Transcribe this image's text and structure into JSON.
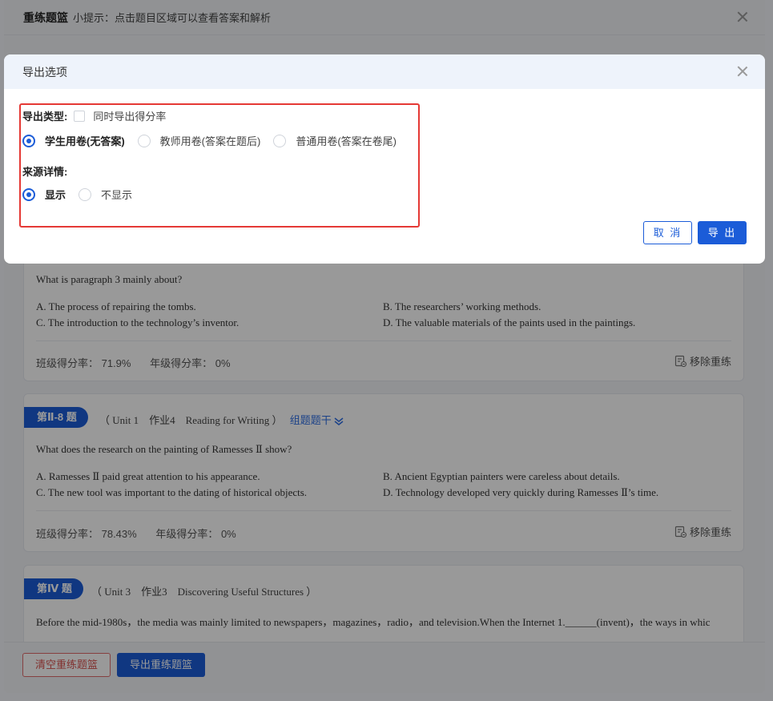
{
  "drawer": {
    "title": "重练题篮",
    "tip": "小提示：点击题目区域可以查看答案和解析"
  },
  "questions": [
    {
      "badge": "",
      "source": "",
      "group_label": "",
      "text": "What is paragraph 3 mainly about?",
      "options": [
        "A. The process of repairing the tombs.",
        "B. The researchers’ working methods.",
        "C. The introduction to the technology’s inventor.",
        "D. The valuable materials of the paints used in the paintings."
      ],
      "class_rate": "班级得分率： 71.9%",
      "grade_rate": "年级得分率： 0%",
      "remove_label": "移除重练"
    },
    {
      "badge": "第Ⅱ-8 题",
      "source": "（ Unit 1　作业4　Reading for Writing ）",
      "group_label": "组题题干",
      "text": "What does the research on the painting of Ramesses Ⅱ show?",
      "options": [
        "A. Ramesses Ⅱ paid great attention to his appearance.",
        "B. Ancient Egyptian painters were careless about details.",
        "C. The new tool was important to the dating of historical objects.",
        "D. Technology developed very quickly during Ramesses Ⅱ’s time."
      ],
      "class_rate": "班级得分率： 78.43%",
      "grade_rate": "年级得分率： 0%",
      "remove_label": "移除重练"
    },
    {
      "badge": "第Ⅳ 题",
      "source": "（ Unit 3　作业3　Discovering Useful Structures ）",
      "text": "Before the mid-1980s，the media was mainly limited to newspapers，magazines，radio，and television.When the Internet 1.______(invent)，the ways in whic"
    }
  ],
  "footer": {
    "clear_label": "清空重练题篮",
    "export_label": "导出重练题篮"
  },
  "modal": {
    "title": "导出选项",
    "export_type_label": "导出类型:",
    "export_rate_label": "同时导出得分率",
    "paper_options": [
      {
        "label": "学生用卷(无答案)",
        "selected": true
      },
      {
        "label": "教师用卷(答案在题后)",
        "selected": false
      },
      {
        "label": "普通用卷(答案在卷尾)",
        "selected": false
      }
    ],
    "source_label": "来源详情:",
    "source_options": [
      {
        "label": "显示",
        "selected": true
      },
      {
        "label": "不显示",
        "selected": false
      }
    ],
    "cancel_label": "取 消",
    "export_label": "导 出"
  },
  "colors": {
    "primary": "#1b5cd8",
    "danger": "#e53935",
    "mask": "rgba(0,0,0,0.40)"
  }
}
